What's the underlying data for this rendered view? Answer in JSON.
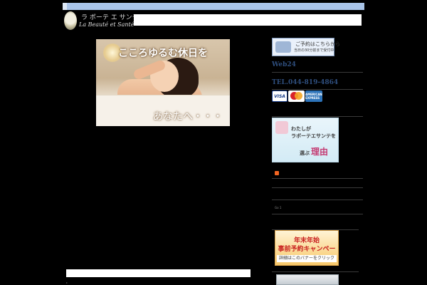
{
  "header": {
    "logo_kana": "ラ ボーテ エ サンテ",
    "logo_latin": "La Beauté et Santé"
  },
  "hero": {
    "headline": "こころゆるむ休日を",
    "tagline": "あなたへ・・・"
  },
  "sidebar": {
    "reserve_banner": {
      "line1": "ご予約はこちらから",
      "line2": "当日の30分前まで受付中"
    },
    "web24": "Web24",
    "tel": "TEL.044-819-4864",
    "cards": {
      "visa": "VISA",
      "amex": "AMERICAN EXPRESS"
    },
    "reason_banner": {
      "line1": "わたしが",
      "line2": "ラボーテエサンテを",
      "line3_small": "選ぶ",
      "line3_big": "理由"
    },
    "small_text": "Go 1",
    "campaign_banner": {
      "line1": "年末年始",
      "line2": "事前予約キャンペーン",
      "line3": "詳細はこのバナーをクリック"
    }
  },
  "colors": {
    "background": "#000000",
    "topbar": "#a9c4e8",
    "link_blue": "#2f4f7f",
    "divider": "#3a3a3a"
  }
}
